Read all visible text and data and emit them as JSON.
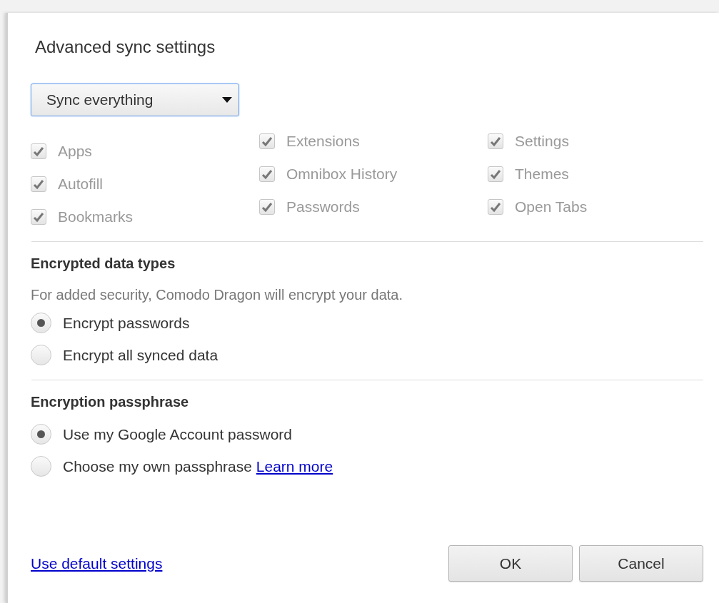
{
  "dialog": {
    "title": "Advanced sync settings",
    "sync_dropdown": {
      "value": "Sync everything"
    },
    "data_types": {
      "disabled": true,
      "columns": [
        [
          {
            "label": "Apps",
            "checked": true
          },
          {
            "label": "Autofill",
            "checked": true
          },
          {
            "label": "Bookmarks",
            "checked": true
          }
        ],
        [
          {
            "label": "Extensions",
            "checked": true
          },
          {
            "label": "Omnibox History",
            "checked": true
          },
          {
            "label": "Passwords",
            "checked": true
          }
        ],
        [
          {
            "label": "Settings",
            "checked": true
          },
          {
            "label": "Themes",
            "checked": true
          },
          {
            "label": "Open Tabs",
            "checked": true
          }
        ]
      ]
    },
    "encryption": {
      "heading": "Encrypted data types",
      "description": "For added security, Comodo Dragon will encrypt your data.",
      "options": [
        {
          "label": "Encrypt passwords",
          "selected": true
        },
        {
          "label": "Encrypt all synced data",
          "selected": false
        }
      ]
    },
    "passphrase": {
      "heading": "Encryption passphrase",
      "options": [
        {
          "label": "Use my Google Account password",
          "selected": true
        },
        {
          "label": "Choose my own passphrase",
          "selected": false,
          "link": "Learn more"
        }
      ]
    },
    "footer": {
      "link": "Use default settings",
      "buttons": [
        "OK",
        "Cancel"
      ]
    }
  }
}
